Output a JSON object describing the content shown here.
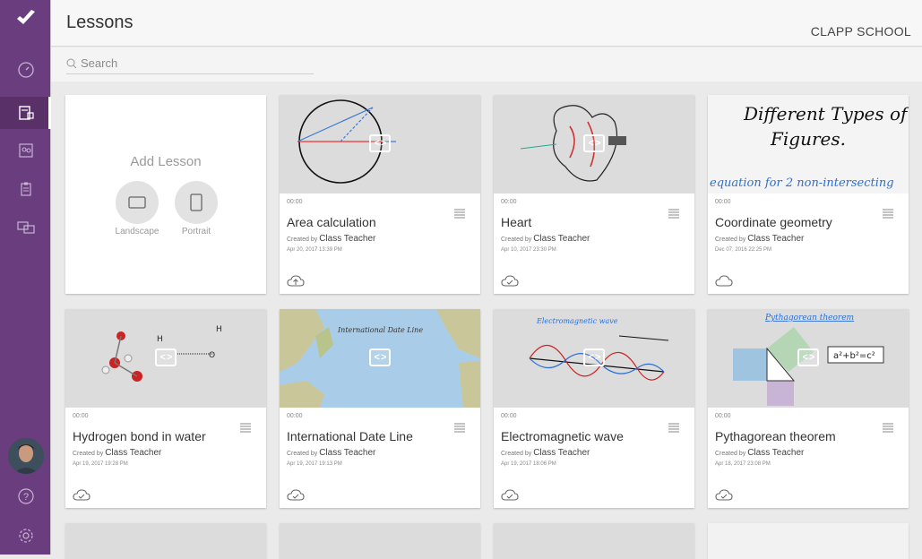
{
  "header": {
    "title": "Lessons",
    "school": "CLAPP SCHOOL"
  },
  "search": {
    "placeholder": "Search"
  },
  "sidebar": {
    "items": [
      {
        "name": "dashboard",
        "icon": "gauge-icon"
      },
      {
        "name": "lessons",
        "icon": "video-lesson-icon",
        "active": true
      },
      {
        "name": "classes",
        "icon": "people-icon"
      },
      {
        "name": "assignments",
        "icon": "clipboard-icon"
      },
      {
        "name": "messages",
        "icon": "chat-icon"
      }
    ],
    "bottom": [
      {
        "name": "help",
        "icon": "help-icon"
      },
      {
        "name": "settings",
        "icon": "gear-icon"
      }
    ]
  },
  "add_lesson": {
    "title": "Add Lesson",
    "landscape": "Landscape",
    "portrait": "Portrait"
  },
  "created_prefix": "Created by",
  "lessons": [
    {
      "duration": "00:00",
      "title": "Area calculation",
      "author": "Class Teacher",
      "date": "Apr 20, 2017 13:39 PM",
      "status": "cloud-upload-icon"
    },
    {
      "duration": "00:00",
      "title": "Heart",
      "author": "Class Teacher",
      "date": "Apr 10, 2017 23:30 PM",
      "status": "cloud-check-icon"
    },
    {
      "duration": "00:00",
      "title": "Coordinate geometry",
      "author": "Class Teacher",
      "date": "Dec 07, 2016 22:25 PM",
      "status": "cloud-icon"
    },
    {
      "duration": "00:00",
      "title": "Hydrogen bond in water",
      "author": "Class Teacher",
      "date": "Apr 19, 2017 19:28 PM",
      "status": "cloud-check-icon"
    },
    {
      "duration": "00:00",
      "title": "International Date Line",
      "author": "Class Teacher",
      "date": "Apr 19, 2017 19:13 PM",
      "status": "cloud-check-icon"
    },
    {
      "duration": "00:00",
      "title": "Electromagnetic wave",
      "author": "Class Teacher",
      "date": "Apr 19, 2017 18:06 PM",
      "status": "cloud-check-icon"
    },
    {
      "duration": "00:00",
      "title": "Pythagorean theorem",
      "author": "Class Teacher",
      "date": "Apr 18, 2017 23:08 PM",
      "status": "cloud-check-icon"
    }
  ],
  "thumb_text": {
    "geometry_line1": "Different Types of",
    "geometry_line2": "Figures.",
    "geometry_line3": "equation for 2 non-intersecting",
    "date_line": "International Date Line",
    "em_wave": "Electromagnetic wave",
    "pythagoras": "Pythagorean theorem",
    "pythagoras_eq": "a²+b²=c²"
  },
  "colors": {
    "sidebar": "#6a3d7e",
    "accent": "#ffffff"
  }
}
